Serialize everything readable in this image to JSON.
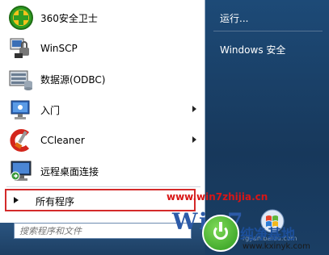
{
  "programs": [
    {
      "label": "360安全卫士",
      "icon": "360-safe-icon",
      "has_submenu": false
    },
    {
      "label": "WinSCP",
      "icon": "winscp-icon",
      "has_submenu": false
    },
    {
      "label": "数据源(ODBC)",
      "icon": "odbc-icon",
      "has_submenu": false
    },
    {
      "label": "入门",
      "icon": "getting-started-icon",
      "has_submenu": true
    },
    {
      "label": "CCleaner",
      "icon": "ccleaner-icon",
      "has_submenu": true
    },
    {
      "label": "远程桌面连接",
      "icon": "remote-desktop-icon",
      "has_submenu": false
    }
  ],
  "all_programs_label": "所有程序",
  "search_placeholder": "搜索程序和文件",
  "right_menu": {
    "run_label": "运行...",
    "security_label": "Windows 安全"
  },
  "watermark": {
    "url": "www.win7zhijia.cn",
    "logo_text": "Win7",
    "site_name": "纯净基地",
    "site_url": "www.kxinyk.com",
    "baidu_mark": "rgyan.baidu.com"
  },
  "colors": {
    "highlight_border": "#d42a2a",
    "right_pane": "#1d4a77",
    "watermark_red": "#d81616"
  }
}
